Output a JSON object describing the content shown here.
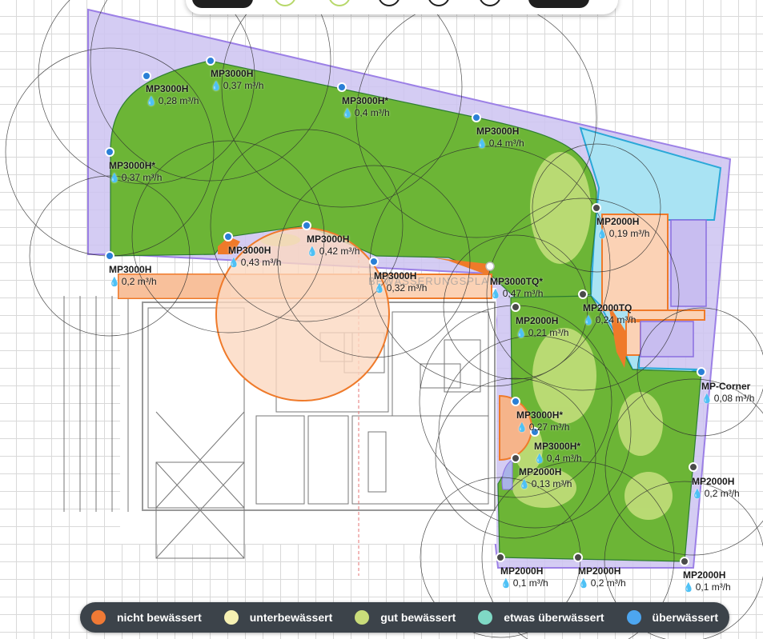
{
  "app": {
    "watermark": "BEWÄSSERUNGSPLANER"
  },
  "sprinklers": [
    {
      "model": "MP3000H",
      "flow": "0,28 m³/h"
    },
    {
      "model": "MP3000H",
      "flow": "0,37 m³/h"
    },
    {
      "model": "MP3000H*",
      "flow": "0,4 m³/h"
    },
    {
      "model": "MP3000H",
      "flow": "0,4 m³/h"
    },
    {
      "model": "MP3000H*",
      "flow": "0,37 m³/h"
    },
    {
      "model": "MP3000H",
      "flow": "0,43 m³/h"
    },
    {
      "model": "MP3000H",
      "flow": "0,42 m³/h"
    },
    {
      "model": "MP3000H",
      "flow": "0,2 m³/h"
    },
    {
      "model": "MP3000H",
      "flow": "0,32 m³/h"
    },
    {
      "model": "MP2000H",
      "flow": "0,19 m³/h"
    },
    {
      "model": "MP3000TQ*",
      "flow": "0,47 m³/h"
    },
    {
      "model": "MP2000TQ",
      "flow": "0,24 m³/h"
    },
    {
      "model": "MP2000H",
      "flow": "0,21 m³/h"
    },
    {
      "model": "MP-Corner",
      "flow": "0,08 m³/h"
    },
    {
      "model": "MP3000H*",
      "flow": "0,27 m³/h"
    },
    {
      "model": "MP3000H*",
      "flow": "0,4 m³/h"
    },
    {
      "model": "MP2000H",
      "flow": "0,13 m³/h"
    },
    {
      "model": "MP2000H",
      "flow": "0,2 m³/h"
    },
    {
      "model": "MP2000H",
      "flow": "0,1 m³/h"
    },
    {
      "model": "MP2000H",
      "flow": "0,2 m³/h"
    },
    {
      "model": "MP2000H",
      "flow": "0,1 m³/h"
    }
  ],
  "legend": [
    {
      "label": "nicht bewässert",
      "color": "#f07a35"
    },
    {
      "label": "unterbewässert",
      "color": "#f6f1b3"
    },
    {
      "label": "gut bewässert",
      "color": "#c9dc7a"
    },
    {
      "label": "etwas überwässert",
      "color": "#7fd9c5"
    },
    {
      "label": "überwässert",
      "color": "#4da6f0"
    }
  ],
  "colors": {
    "property": "#c9bdf0",
    "lawn": "#72b63a",
    "overwatered_light": "#a8e2f2",
    "terrace": "#fbd8c1",
    "orange": "#ef7a2a",
    "legend_bg": "#3c434a"
  },
  "icons": {
    "drop": "droplet-icon"
  }
}
